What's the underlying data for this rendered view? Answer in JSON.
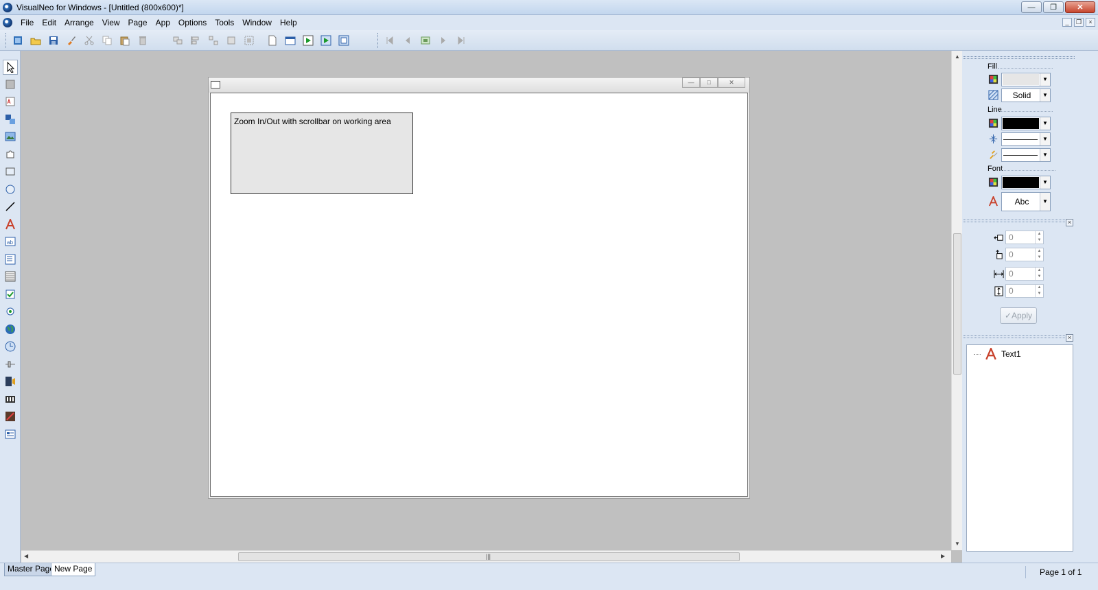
{
  "window": {
    "title": "VisualNeo for Windows - [Untitled (800x600)*]"
  },
  "menu": {
    "items": [
      "File",
      "Edit",
      "Arrange",
      "View",
      "Page",
      "App",
      "Options",
      "Tools",
      "Window",
      "Help"
    ]
  },
  "page_window": {
    "text_object": "Zoom In/Out with scrollbar on working area"
  },
  "properties": {
    "fill_label": "Fill",
    "fill_style": "Solid",
    "fill_color": "#e6e6e6",
    "line_label": "Line",
    "line_color": "#000000",
    "font_label": "Font",
    "font_color": "#000000",
    "font_sample": "Abc"
  },
  "position": {
    "left": "0",
    "top": "0",
    "width": "0",
    "height": "0",
    "apply_label": "Apply"
  },
  "objects": {
    "items": [
      "Text1"
    ]
  },
  "status": {
    "tabs": [
      "Master Page",
      "New Page"
    ],
    "page_indicator": "Page 1 of 1"
  },
  "icons": {
    "toolbar": [
      "new-project-icon",
      "open-icon",
      "save-icon",
      "brush-icon",
      "cut-icon",
      "copy-icon",
      "paste-icon",
      "delete-icon",
      "group-icon",
      "align-icon",
      "distribute-icon",
      "size-icon",
      "select-all-icon",
      "new-page-icon",
      "page-properties-icon",
      "run-icon",
      "run-full-icon",
      "compile-icon",
      "first-page-icon",
      "prev-page-icon",
      "page-list-icon",
      "next-page-icon",
      "last-page-icon"
    ],
    "tools": [
      "pointer-icon",
      "container-icon",
      "text-object-icon",
      "hotspot-icon",
      "image-icon",
      "puzzle-icon",
      "rectangle-icon",
      "ellipse-icon",
      "line-icon",
      "text-icon",
      "edit-box-icon",
      "memo-icon",
      "list-box-icon",
      "checkbox-icon",
      "radio-button-icon",
      "browser-icon",
      "timer-icon",
      "slider-icon",
      "media-player-icon",
      "film-icon",
      "clip-icon",
      "form-icon"
    ]
  }
}
